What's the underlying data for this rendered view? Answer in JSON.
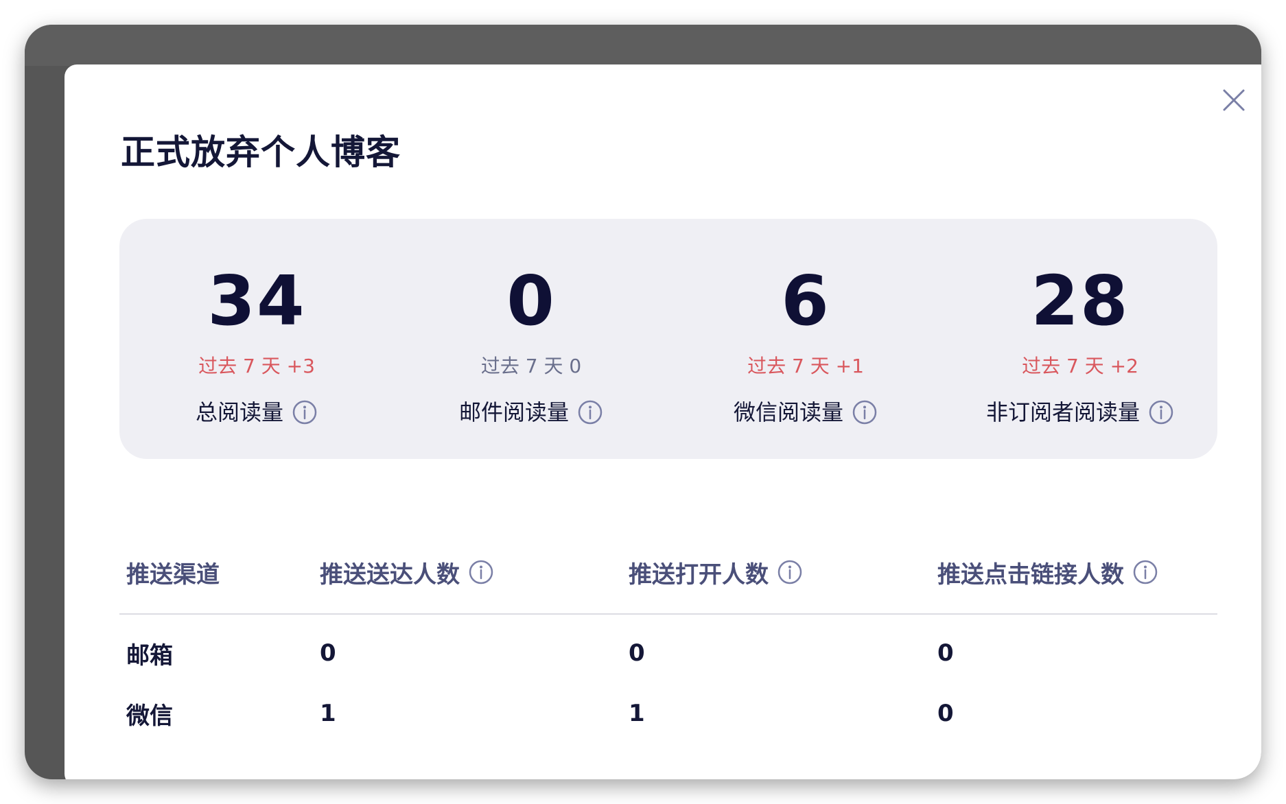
{
  "modal": {
    "title": "正式放弃个人博客",
    "close_icon": "close-icon"
  },
  "stats": [
    {
      "value": "34",
      "change": "过去 7 天 +3",
      "change_positive": true,
      "label": "总阅读量"
    },
    {
      "value": "0",
      "change": "过去 7 天 0",
      "change_positive": false,
      "label": "邮件阅读量"
    },
    {
      "value": "6",
      "change": "过去 7 天 +1",
      "change_positive": true,
      "label": "微信阅读量"
    },
    {
      "value": "28",
      "change": "过去 7 天 +2",
      "change_positive": true,
      "label": "非订阅者阅读量"
    }
  ],
  "table": {
    "headers": {
      "channel": "推送渠道",
      "delivered": "推送送达人数",
      "opened": "推送打开人数",
      "clicked": "推送点击链接人数"
    },
    "rows": [
      {
        "channel": "邮箱",
        "delivered": "0",
        "opened": "0",
        "clicked": "0"
      },
      {
        "channel": "微信",
        "delivered": "1",
        "opened": "1",
        "clicked": "0"
      }
    ]
  },
  "colors": {
    "title": "#141737",
    "positive_change": "#d9575d",
    "neutral_change": "#6a6f8c",
    "card_bg": "#efeff4",
    "header_text": "#4a4f79"
  }
}
